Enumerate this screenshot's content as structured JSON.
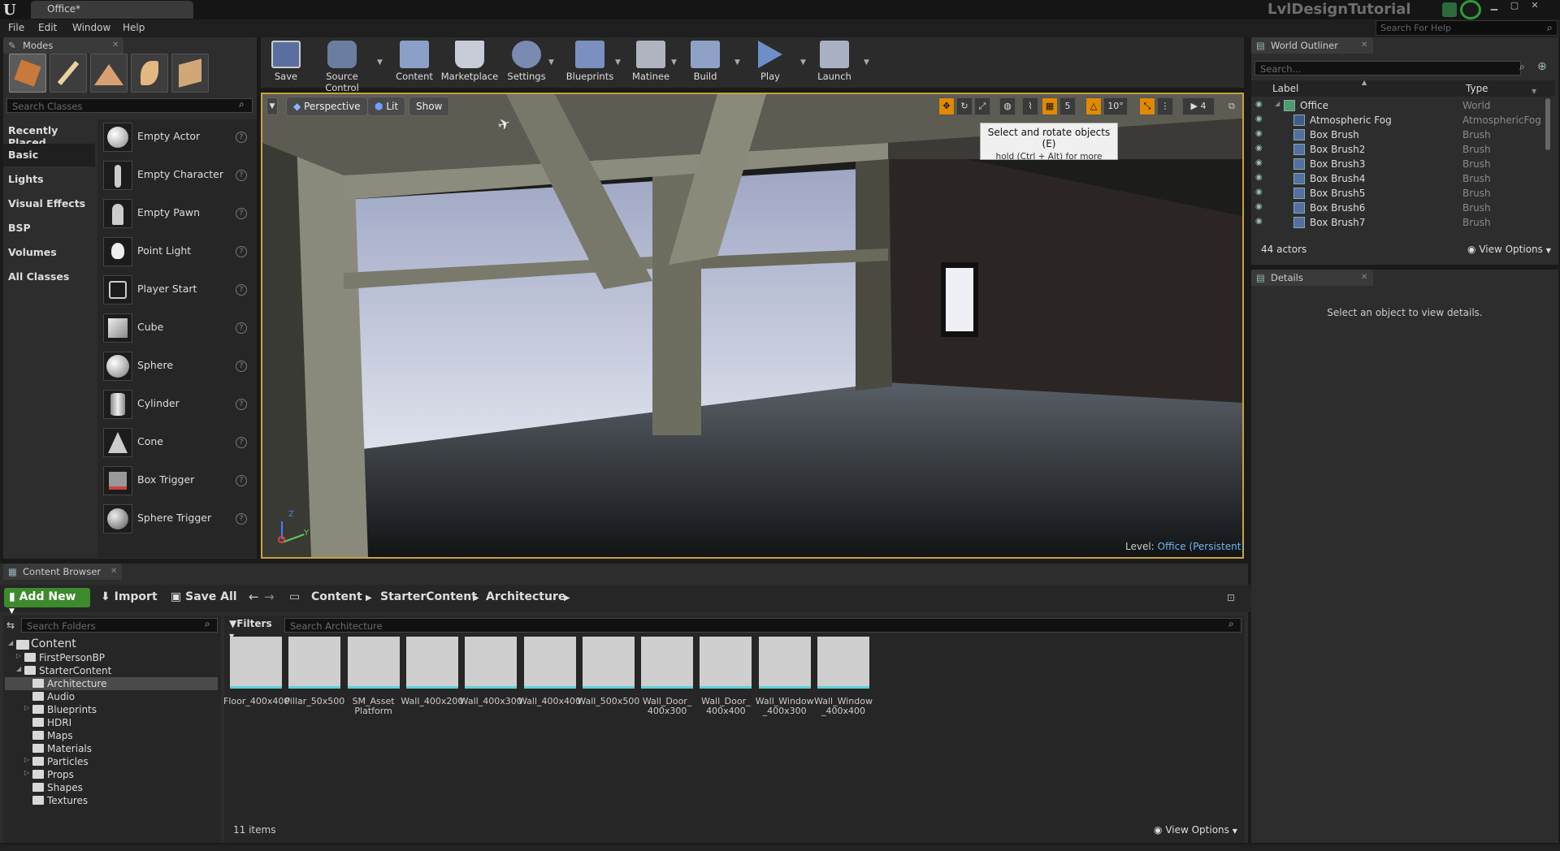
{
  "window": {
    "doc_tab": "Office*",
    "app_title": "LvlDesignTutorial",
    "help_search_placeholder": "Search For Help"
  },
  "menu": [
    "File",
    "Edit",
    "Window",
    "Help"
  ],
  "modes_panel": {
    "tab": "Modes",
    "search_placeholder": "Search Classes",
    "categories": [
      "Recently Placed",
      "Basic",
      "Lights",
      "Visual Effects",
      "BSP",
      "Volumes",
      "All Classes"
    ],
    "selected_category": "Basic",
    "items": [
      "Empty Actor",
      "Empty Character",
      "Empty Pawn",
      "Point Light",
      "Player Start",
      "Cube",
      "Sphere",
      "Cylinder",
      "Cone",
      "Box Trigger",
      "Sphere Trigger"
    ],
    "help_glyph": "?"
  },
  "toolbar": [
    {
      "label": "Save",
      "icon": "save-icon"
    },
    {
      "label": "Source Control",
      "icon": "source-control-icon"
    },
    {
      "label": "Content",
      "icon": "content-icon"
    },
    {
      "label": "Marketplace",
      "icon": "marketplace-icon"
    },
    {
      "label": "Settings",
      "icon": "settings-icon"
    },
    {
      "label": "Blueprints",
      "icon": "blueprints-icon"
    },
    {
      "label": "Matinee",
      "icon": "matinee-icon"
    },
    {
      "label": "Build",
      "icon": "build-icon"
    },
    {
      "label": "Play",
      "icon": "play-icon"
    },
    {
      "label": "Launch",
      "icon": "launch-icon"
    }
  ],
  "viewport": {
    "perspective": "Perspective",
    "lit": "Lit",
    "show": "Show",
    "tooltip_title": "Select and rotate objects (E)",
    "tooltip_sub": "hold (Ctrl + Alt) for more",
    "grid_value": "5",
    "angle_value": "10°",
    "camera_speed": "4",
    "level_label": "Level:",
    "level_name": "Office (Persistent)",
    "axis_z": "Z",
    "axis_y": "Y"
  },
  "outliner": {
    "tab": "World Outliner",
    "search_placeholder": "Search...",
    "col_label": "Label",
    "col_type": "Type",
    "rows": [
      {
        "label": "Office",
        "type": "World"
      },
      {
        "label": "Atmospheric Fog",
        "type": "AtmosphericFog"
      },
      {
        "label": "Box Brush",
        "type": "Brush"
      },
      {
        "label": "Box Brush2",
        "type": "Brush"
      },
      {
        "label": "Box Brush3",
        "type": "Brush"
      },
      {
        "label": "Box Brush4",
        "type": "Brush"
      },
      {
        "label": "Box Brush5",
        "type": "Brush"
      },
      {
        "label": "Box Brush6",
        "type": "Brush"
      },
      {
        "label": "Box Brush7",
        "type": "Brush"
      }
    ],
    "actor_count": "44 actors",
    "view_options": "View Options"
  },
  "details": {
    "tab": "Details",
    "empty_text": "Select an object to view details."
  },
  "content_browser": {
    "tab": "Content Browser",
    "add_new": "Add New",
    "import": "Import",
    "save_all": "Save All",
    "breadcrumbs": [
      "Content",
      "StarterContent",
      "Architecture"
    ],
    "folder_search_placeholder": "Search Folders",
    "filters": "Filters",
    "asset_search_placeholder": "Search Architecture",
    "folders": [
      {
        "name": "Content",
        "depth": 0,
        "expanded": true
      },
      {
        "name": "FirstPersonBP",
        "depth": 1
      },
      {
        "name": "StarterContent",
        "depth": 1,
        "expanded": true
      },
      {
        "name": "Architecture",
        "depth": 2,
        "selected": true
      },
      {
        "name": "Audio",
        "depth": 2
      },
      {
        "name": "Blueprints",
        "depth": 2
      },
      {
        "name": "HDRI",
        "depth": 2
      },
      {
        "name": "Maps",
        "depth": 2
      },
      {
        "name": "Materials",
        "depth": 2
      },
      {
        "name": "Particles",
        "depth": 2
      },
      {
        "name": "Props",
        "depth": 2
      },
      {
        "name": "Shapes",
        "depth": 2
      },
      {
        "name": "Textures",
        "depth": 2
      }
    ],
    "assets": [
      {
        "line1": "Floor_400x400",
        "line2": ""
      },
      {
        "line1": "Pillar_50x500",
        "line2": ""
      },
      {
        "line1": "SM_Asset",
        "line2": "Platform"
      },
      {
        "line1": "Wall_400x200",
        "line2": ""
      },
      {
        "line1": "Wall_400x300",
        "line2": ""
      },
      {
        "line1": "Wall_400x400",
        "line2": ""
      },
      {
        "line1": "Wall_500x500",
        "line2": ""
      },
      {
        "line1": "Wall_Door_",
        "line2": "400x300"
      },
      {
        "line1": "Wall_Door_",
        "line2": "400x400"
      },
      {
        "line1": "Wall_Window",
        "line2": "_400x300"
      },
      {
        "line1": "Wall_Window",
        "line2": "_400x400"
      }
    ],
    "item_count": "11 items",
    "view_options": "View Options"
  },
  "colors": {
    "accent_orange": "#e08a00",
    "add_new_green": "#3d8b2c",
    "asset_underline": "#5bd1d8",
    "level_link": "#6fb6e8"
  }
}
